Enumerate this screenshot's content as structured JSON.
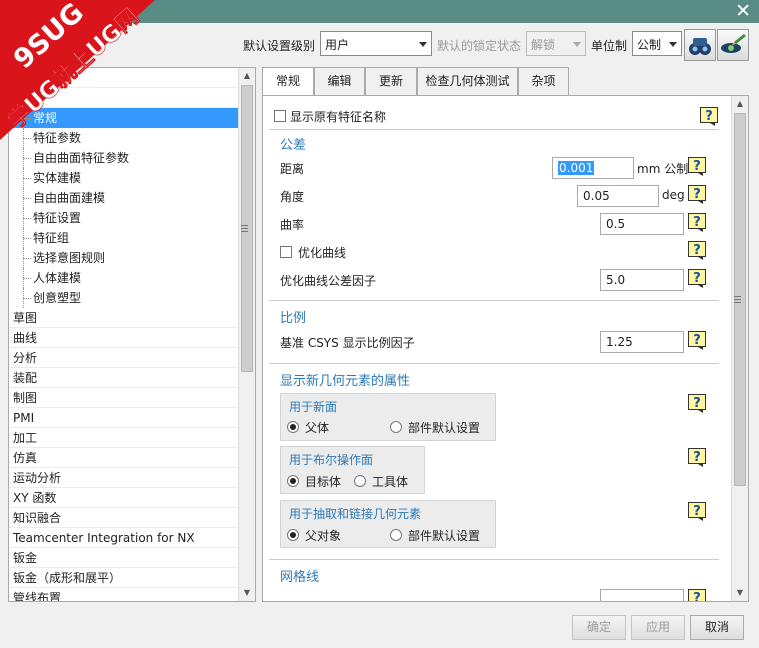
{
  "watermark": {
    "line1": "9SUG",
    "line2": "学UG就上UG网"
  },
  "toolbar": {
    "default_level_label": "默认设置级别",
    "default_level_value": "用户",
    "lock_state_label": "默认的锁定状态",
    "lock_state_value": "解锁",
    "unit_label": "单位制",
    "unit_value": "公制"
  },
  "tree": {
    "items": [
      {
        "label": "",
        "kind": "top"
      },
      {
        "label": "建模",
        "kind": "top"
      },
      {
        "label": "常规",
        "kind": "child",
        "selected": true
      },
      {
        "label": "特征参数",
        "kind": "child"
      },
      {
        "label": "自由曲面特征参数",
        "kind": "child"
      },
      {
        "label": "实体建模",
        "kind": "child"
      },
      {
        "label": "自由曲面建模",
        "kind": "child"
      },
      {
        "label": "特征设置",
        "kind": "child"
      },
      {
        "label": "特征组",
        "kind": "child"
      },
      {
        "label": "选择意图规则",
        "kind": "child"
      },
      {
        "label": "人体建模",
        "kind": "child"
      },
      {
        "label": "创意塑型",
        "kind": "child"
      },
      {
        "label": "草图",
        "kind": "top"
      },
      {
        "label": "曲线",
        "kind": "top"
      },
      {
        "label": "分析",
        "kind": "top"
      },
      {
        "label": "装配",
        "kind": "top"
      },
      {
        "label": "制图",
        "kind": "top"
      },
      {
        "label": "PMI",
        "kind": "top"
      },
      {
        "label": "加工",
        "kind": "top"
      },
      {
        "label": "仿真",
        "kind": "top"
      },
      {
        "label": "运动分析",
        "kind": "top"
      },
      {
        "label": "XY 函数",
        "kind": "top"
      },
      {
        "label": "知识融合",
        "kind": "top"
      },
      {
        "label": "Teamcenter Integration for NX",
        "kind": "top"
      },
      {
        "label": "钣金",
        "kind": "top"
      },
      {
        "label": "钣金（成形和展平）",
        "kind": "top"
      },
      {
        "label": "管线布置",
        "kind": "top"
      }
    ]
  },
  "tabs": [
    "常规",
    "编辑",
    "更新",
    "检查几何体测试",
    "杂项"
  ],
  "panel": {
    "show_feature_name": "显示原有特征名称",
    "tolerance_section": "公差",
    "distance_label": "距离",
    "distance_value": "0.001",
    "distance_unit": "mm 公制",
    "angle_label": "角度",
    "angle_value": "0.05",
    "angle_unit": "deg",
    "curvature_label": "曲率",
    "curvature_value": "0.5",
    "optimize_curve": "优化曲线",
    "optimize_factor_label": "优化曲线公差因子",
    "optimize_factor_value": "5.0",
    "scale_section": "比例",
    "csys_label": "基准 CSYS 显示比例因子",
    "csys_value": "1.25",
    "new_geom_section": "显示新几何元素的属性",
    "group_face_title": "用于新面",
    "group_face_opt1": "父体",
    "group_face_opt2": "部件默认设置",
    "group_bool_title": "用于布尔操作面",
    "group_bool_opt1": "目标体",
    "group_bool_opt2": "工具体",
    "group_extract_title": "用于抽取和链接几何元素",
    "group_extract_opt1": "父对象",
    "group_extract_opt2": "部件默认设置",
    "mesh_section": "网格线"
  },
  "buttons": {
    "ok": "确定",
    "apply": "应用",
    "cancel": "取消"
  }
}
